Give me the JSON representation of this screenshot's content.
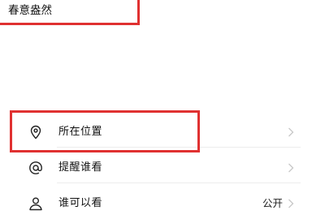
{
  "post": {
    "text": "春意盎然"
  },
  "menu": {
    "items": [
      {
        "label": "所在位置",
        "icon": "location-pin-icon"
      },
      {
        "label": "提醒谁看",
        "icon": "at-sign-icon"
      },
      {
        "label": "谁可以看",
        "icon": "person-icon",
        "value": "公开"
      }
    ]
  },
  "colors": {
    "highlight": "#e03131",
    "chevron": "#c7c7c7",
    "icon": "#222222"
  }
}
